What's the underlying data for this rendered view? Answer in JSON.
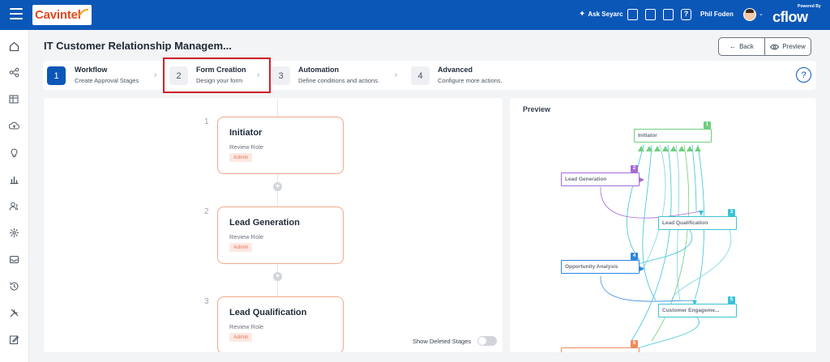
{
  "header": {
    "brand": "Cavintel",
    "ask_label": "Ask Seyarc",
    "user_name": "Phil Foden",
    "powered_by": "Powered By",
    "product": "cflow",
    "help": "?"
  },
  "sidebar": {
    "icons": [
      "home-icon",
      "share-icon",
      "table-settings-icon",
      "cloud-upload-icon",
      "lightbulb-icon",
      "bar-chart-icon",
      "users-icon",
      "network-icon",
      "tray-icon",
      "history-icon",
      "tools-icon",
      "edit-icon"
    ]
  },
  "page": {
    "title": "IT Customer Relationship Managem...",
    "back_label": "Back",
    "preview_label": "Preview"
  },
  "stepper": {
    "steps": [
      {
        "num": "1",
        "title": "Workflow",
        "subtitle": "Create Approval Stages",
        "active": true
      },
      {
        "num": "2",
        "title": "Form Creation",
        "subtitle": "Design your form",
        "active": false
      },
      {
        "num": "3",
        "title": "Automation",
        "subtitle": "Define conditions and actions.",
        "active": false
      },
      {
        "num": "4",
        "title": "Advanced",
        "subtitle": "Configure more actions.",
        "active": false
      }
    ],
    "help": "?"
  },
  "workflow": {
    "stages": [
      {
        "index": "1",
        "title": "Initiator",
        "role": "Review Role",
        "badge": "Admin"
      },
      {
        "index": "2",
        "title": "Lead Generation",
        "role": "Review Role",
        "badge": "Admin"
      },
      {
        "index": "3",
        "title": "Lead Qualification",
        "role": "Review Role",
        "badge": "Admin"
      }
    ],
    "add_symbol": "+",
    "show_deleted_label": "Show Deleted Stages",
    "show_deleted_on": false
  },
  "preview": {
    "title": "Preview",
    "nodes": [
      {
        "label": "Initiator",
        "badge": "1",
        "color": "#6fcf7f"
      },
      {
        "label": "Lead Generation",
        "badge": "2",
        "color": "#a56ad6"
      },
      {
        "label": "Lead Qualification",
        "badge": "3",
        "color": "#39c3d8"
      },
      {
        "label": "Opportunity Analysis",
        "badge": "4",
        "color": "#2e86de"
      },
      {
        "label": "Customer Engageme...",
        "badge": "5",
        "color": "#39c3d8"
      },
      {
        "label": "",
        "badge": "6",
        "color": "#f08c5a"
      }
    ]
  },
  "colors": {
    "brand_blue": "#0b57b8",
    "highlight_red": "#d0202a",
    "card_border": "#f0a98a"
  }
}
